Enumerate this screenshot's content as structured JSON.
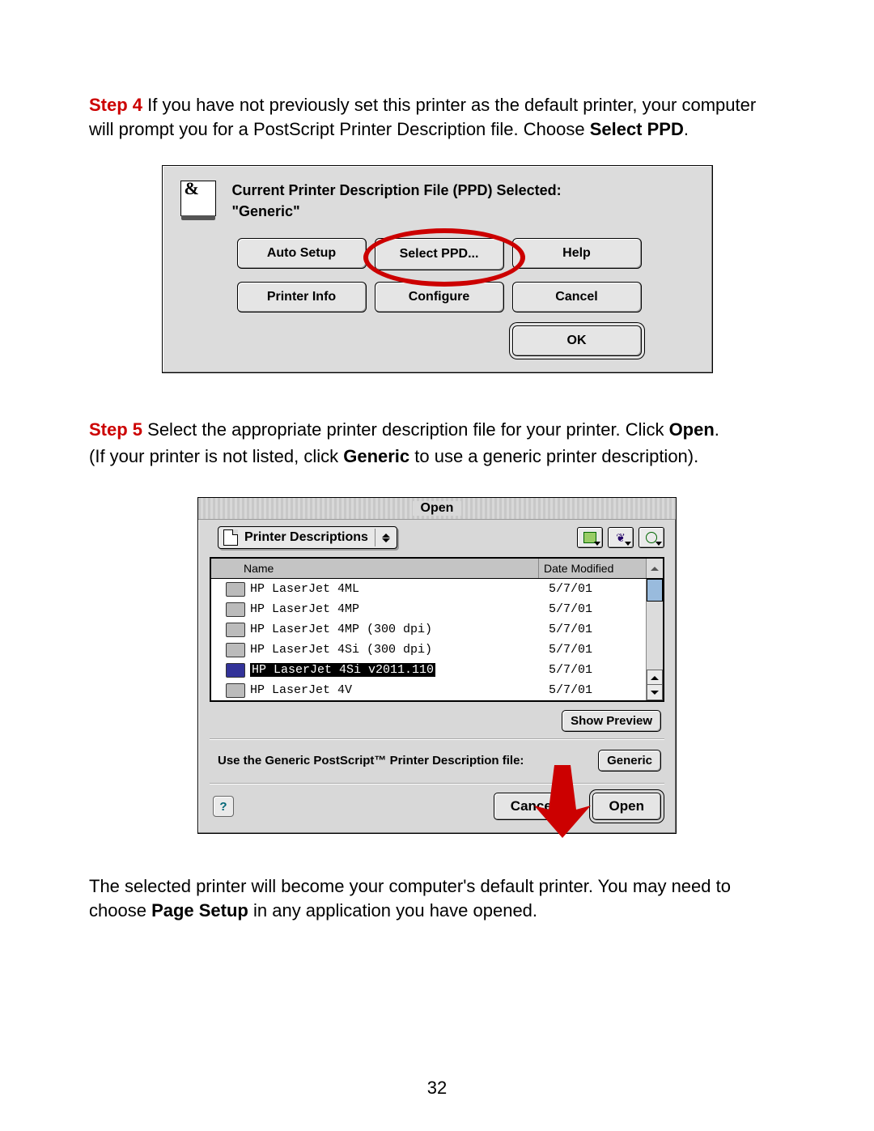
{
  "page_number": "32",
  "step4": {
    "label": "Step 4",
    "text_before": " If you have not previously set this printer as the default printer, your computer will prompt you for a PostScript Printer Description file. Choose ",
    "bold": "Select PPD",
    "period": "."
  },
  "step5": {
    "label": "Step 5",
    "text1_before": " Select the appropriate printer description file for your printer. Click ",
    "text1_bold": "Open",
    "text1_after": ".",
    "text2_before": "(If your printer is not listed, click ",
    "text2_bold": "Generic",
    "text2_after": " to use a generic printer description)."
  },
  "closing": {
    "text_before": "The selected printer will become your computer's default printer. You may need to choose ",
    "bold": "Page Setup",
    "text_after": " in any application you have opened."
  },
  "dlg1": {
    "title_line1": "Current Printer Description File (PPD) Selected:",
    "title_line2": "\"Generic\"",
    "buttons": {
      "auto_setup": "Auto Setup",
      "select_ppd": "Select PPD...",
      "help": "Help",
      "printer_info": "Printer Info",
      "configure": "Configure",
      "cancel": "Cancel",
      "ok": "OK"
    }
  },
  "dlg2": {
    "title": "Open",
    "popup_label": "Printer Descriptions",
    "columns": {
      "name": "Name",
      "date": "Date Modified"
    },
    "rows": [
      {
        "name": "HP LaserJet 4ML",
        "date": "5/7/01",
        "selected": false
      },
      {
        "name": "HP LaserJet 4MP",
        "date": "5/7/01",
        "selected": false
      },
      {
        "name": "HP LaserJet 4MP (300 dpi)",
        "date": "5/7/01",
        "selected": false
      },
      {
        "name": "HP LaserJet 4Si (300 dpi)",
        "date": "5/7/01",
        "selected": false
      },
      {
        "name": "HP LaserJet 4Si v2011.110",
        "date": "5/7/01",
        "selected": true
      },
      {
        "name": "HP LaserJet 4V",
        "date": "5/7/01",
        "selected": false
      }
    ],
    "show_preview": "Show Preview",
    "generic_label": "Use the Generic PostScript™ Printer Description file:",
    "generic_btn": "Generic",
    "cancel": "Cancel",
    "open": "Open"
  }
}
